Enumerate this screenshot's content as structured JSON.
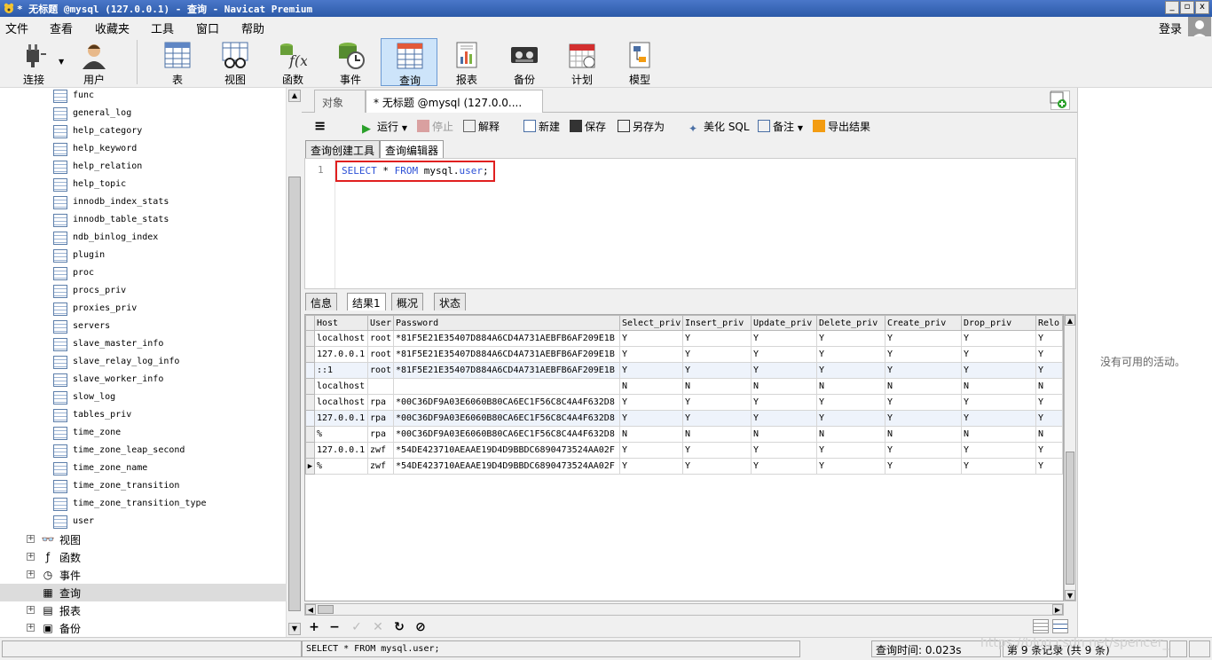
{
  "window": {
    "title": "* 无标题 @mysql (127.0.0.1) - 查询 - Navicat Premium",
    "minimize": "_",
    "restore": "▫",
    "close": "x"
  },
  "menu": [
    "文件",
    "查看",
    "收藏夹",
    "工具",
    "窗口",
    "帮助"
  ],
  "login_label": "登录",
  "toolbar": [
    {
      "label": "连接",
      "icon": "plug-icon"
    },
    {
      "label": "用户",
      "icon": "user-icon"
    },
    {
      "label": "表",
      "icon": "table-icon"
    },
    {
      "label": "视图",
      "icon": "view-glasses-icon"
    },
    {
      "label": "函数",
      "icon": "function-icon"
    },
    {
      "label": "事件",
      "icon": "event-clock-icon"
    },
    {
      "label": "查询",
      "icon": "query-icon",
      "active": true
    },
    {
      "label": "报表",
      "icon": "report-icon"
    },
    {
      "label": "备份",
      "icon": "backup-tape-icon"
    },
    {
      "label": "计划",
      "icon": "calendar-icon"
    },
    {
      "label": "模型",
      "icon": "model-icon"
    }
  ],
  "nav": {
    "tables": [
      "func",
      "general_log",
      "help_category",
      "help_keyword",
      "help_relation",
      "help_topic",
      "innodb_index_stats",
      "innodb_table_stats",
      "ndb_binlog_index",
      "plugin",
      "proc",
      "procs_priv",
      "proxies_priv",
      "servers",
      "slave_master_info",
      "slave_relay_log_info",
      "slave_worker_info",
      "slow_log",
      "tables_priv",
      "time_zone",
      "time_zone_leap_second",
      "time_zone_name",
      "time_zone_transition",
      "time_zone_transition_type",
      "user"
    ],
    "groups": [
      {
        "label": "视图",
        "icon": "view-glasses-icon",
        "glyph": "👓",
        "expander": "+"
      },
      {
        "label": "函数",
        "icon": "function-icon",
        "glyph": "ƒ",
        "expander": "+"
      },
      {
        "label": "事件",
        "icon": "event-clock-icon",
        "glyph": "◷",
        "expander": "+"
      },
      {
        "label": "查询",
        "icon": "query-icon",
        "glyph": "▦",
        "expander": "",
        "selected": true
      },
      {
        "label": "报表",
        "icon": "report-icon",
        "glyph": "▤",
        "expander": "+"
      },
      {
        "label": "备份",
        "icon": "backup-tape-icon",
        "glyph": "▣",
        "expander": "+"
      }
    ]
  },
  "tabs": {
    "objects": "对象",
    "query_tab": "* 无标题 @mysql (127.0.0....",
    "add_icon": "+"
  },
  "query_toolbar": {
    "menu_icon": "≡",
    "run": "运行",
    "stop": "停止",
    "explain": "解释",
    "new": "新建",
    "save": "保存",
    "save_as": "另存为",
    "beautify": "美化 SQL",
    "comment": "备注",
    "export": "导出结果"
  },
  "sub_tabs": [
    "查询创建工具",
    "查询编辑器"
  ],
  "editor": {
    "line": "1",
    "kw_select": "SELECT",
    "star": " * ",
    "kw_from": "FROM",
    "schema": " mysql.",
    "table": "user",
    "end": ";"
  },
  "result_tabs": [
    "信息",
    "结果1",
    "概况",
    "状态"
  ],
  "grid": {
    "columns": [
      "Host",
      "User",
      "Password",
      "Select_priv",
      "Insert_priv",
      "Update_priv",
      "Delete_priv",
      "Create_priv",
      "Drop_priv",
      "Relo"
    ],
    "rows": [
      [
        "localhost",
        "root",
        "*81F5E21E35407D884A6CD4A731AEBFB6AF209E1B",
        "Y",
        "Y",
        "Y",
        "Y",
        "Y",
        "Y",
        "Y"
      ],
      [
        "127.0.0.1",
        "root",
        "*81F5E21E35407D884A6CD4A731AEBFB6AF209E1B",
        "Y",
        "Y",
        "Y",
        "Y",
        "Y",
        "Y",
        "Y"
      ],
      [
        "::1",
        "root",
        "*81F5E21E35407D884A6CD4A731AEBFB6AF209E1B",
        "Y",
        "Y",
        "Y",
        "Y",
        "Y",
        "Y",
        "Y"
      ],
      [
        "localhost",
        "",
        "",
        "N",
        "N",
        "N",
        "N",
        "N",
        "N",
        "N"
      ],
      [
        "localhost",
        "rpa",
        "*00C36DF9A03E6060B80CA6EC1F56C8C4A4F632D8",
        "Y",
        "Y",
        "Y",
        "Y",
        "Y",
        "Y",
        "Y"
      ],
      [
        "127.0.0.1",
        "rpa",
        "*00C36DF9A03E6060B80CA6EC1F56C8C4A4F632D8",
        "Y",
        "Y",
        "Y",
        "Y",
        "Y",
        "Y",
        "Y"
      ],
      [
        "%",
        "rpa",
        "*00C36DF9A03E6060B80CA6EC1F56C8C4A4F632D8",
        "N",
        "N",
        "N",
        "N",
        "N",
        "N",
        "N"
      ],
      [
        "127.0.0.1",
        "zwf",
        "*54DE423710AEAAE19D4D9BBDC6890473524AA02F",
        "Y",
        "Y",
        "Y",
        "Y",
        "Y",
        "Y",
        "Y"
      ],
      [
        "%",
        "zwf",
        "*54DE423710AEAAE19D4D9BBDC6890473524AA02F",
        "Y",
        "Y",
        "Y",
        "Y",
        "Y",
        "Y",
        "Y"
      ]
    ],
    "current_row": 8,
    "current_marker": "▶"
  },
  "grid_tools": {
    "add": "+",
    "remove": "−",
    "apply": "✓",
    "cancel": "✕",
    "refresh": "↻",
    "stop": "⊘"
  },
  "right_panel": {
    "empty_text": "没有可用的活动。"
  },
  "status": {
    "sql": "SELECT * FROM mysql.user;",
    "query_time": "查询时间: 0.023s",
    "record": "第 9 条记录 (共 9 条)"
  },
  "watermark": "https://blog.csdn.net/spencer_"
}
